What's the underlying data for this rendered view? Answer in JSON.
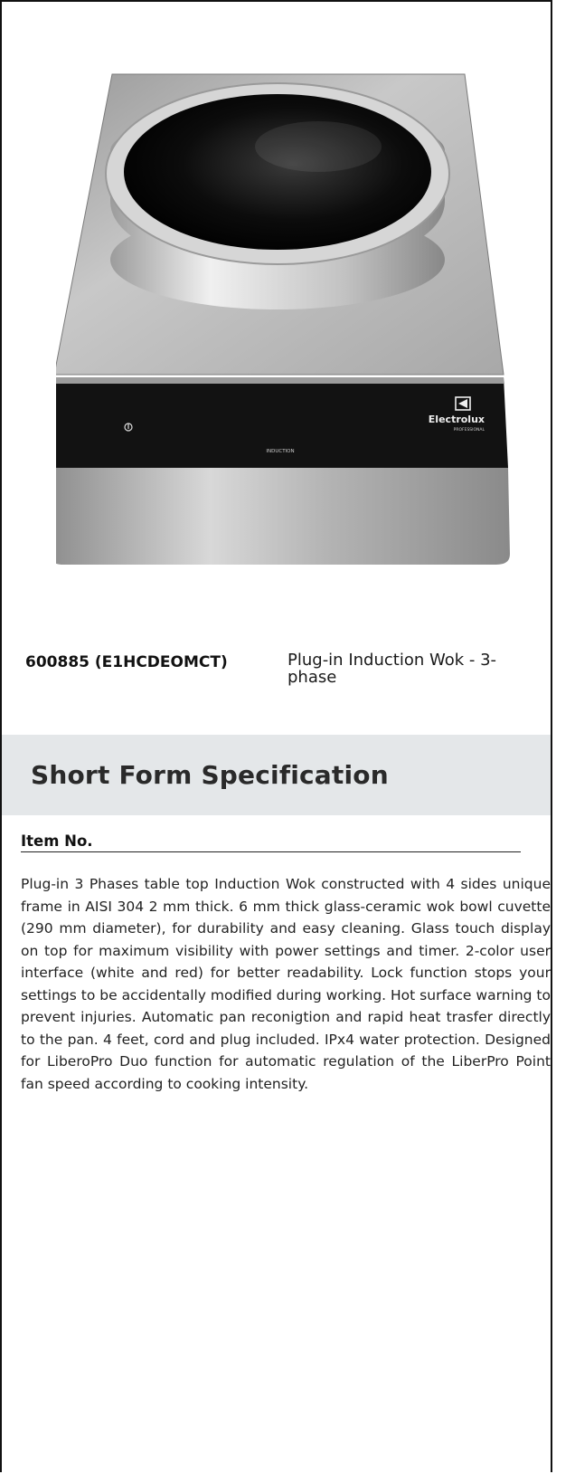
{
  "product": {
    "code": "600885 (E1HCDEOMCT)",
    "description": "Plug-in Induction Wok - 3-phase",
    "image": {
      "brand": "Electrolux",
      "brand_sub": "PROFESSIONAL",
      "panel_label": "INDUCTION",
      "colors": {
        "steel": "#bcbcbc",
        "glass": "#0e0e0e",
        "panel": "#1a1a1a"
      }
    }
  },
  "spec": {
    "title": "Short Form Specification",
    "item_label": "Item No.",
    "text": "Plug-in 3 Phases table top Induction Wok constructed with 4 sides unique frame in AISI 304 2 mm thick. 6 mm thick glass-ceramic wok bowl cuvette (290 mm diameter), for durability and easy cleaning. Glass touch display on top for maximum visibility with power settings and timer. 2-color user interface (white and red) for better readability. Lock function stops your settings to be accidentally modified during working. Hot surface warning to prevent injuries. Automatic pan reconigtion and rapid heat trasfer directly to the pan. 4 feet, cord and plug included. IPx4 water protection. Designed for LiberoPro Duo function for automatic regulation of the LiberPro Point fan speed according to cooking intensity.",
    "band_color": "#e4e7e9"
  }
}
